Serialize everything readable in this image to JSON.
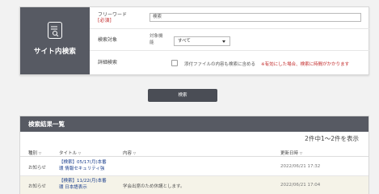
{
  "sidebar": {
    "title": "サイト内検索",
    "icon": "document-search-icon"
  },
  "form": {
    "freeword": {
      "label": "フリーワード",
      "required_tag": "[必須]",
      "value": "検索"
    },
    "target": {
      "label": "検索対象",
      "sub_label_1": "対象機",
      "sub_label_2": "能",
      "selected": "すべて"
    },
    "detail": {
      "label": "詳細検索",
      "checkbox_label": "添付ファイルの内容も検索に含める",
      "warning": "※有効にした場合、検索に時間がかかります",
      "checked": false
    }
  },
  "search_button": {
    "label": "検索"
  },
  "results": {
    "header": "検索結果一覧",
    "count": "2件中1〜2件を表示",
    "columns": {
      "type": "種別",
      "title": "タイトル",
      "content": "内容",
      "updated": "更新日時",
      "sort_mark": "▽"
    },
    "rows": [
      {
        "type": "お知らせ",
        "title_line1": "【検索】05/17(月)本番",
        "title_line2": "環 情報セキュリティ強",
        "content": "",
        "updated": "2022/06/21 17:32"
      },
      {
        "type": "お知らせ",
        "title_line1": "【検索】11/22(月)本番",
        "title_line2": "環 日本語表示",
        "content": "学会出席のため休講とします。",
        "updated": "2022/06/21 17:04"
      }
    ]
  },
  "colors": {
    "header_bg": "#575a63",
    "button_bg": "#4a4d55",
    "required": "#c22a2a",
    "link": "#1a3e8c",
    "highlight_row": "#f5f3e8"
  }
}
